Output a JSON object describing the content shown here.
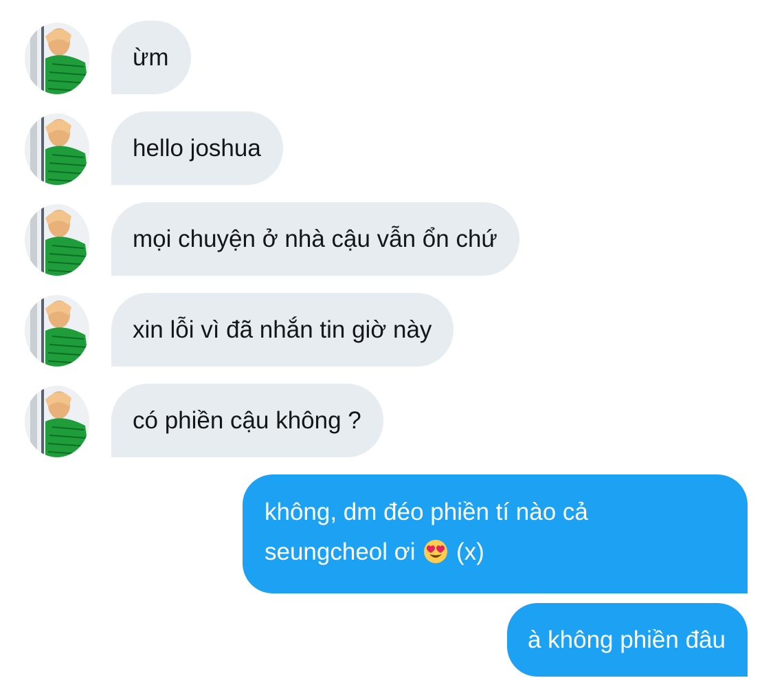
{
  "conversation": {
    "incoming": [
      {
        "text": "ừm"
      },
      {
        "text": "hello joshua"
      },
      {
        "text": "mọi chuyện ở nhà cậu vẫn ổn chứ"
      },
      {
        "text": "xin lỗi vì đã nhắn tin giờ này"
      },
      {
        "text": "có phiền cậu không ?"
      }
    ],
    "outgoing": [
      {
        "line1": "không, dm đéo phiền tí nào cả",
        "line2_before": "seungcheol ơi",
        "line2_emoji": "heart-eyes-emoji",
        "line2_after": "(x)"
      },
      {
        "text": "à không phiền đâu"
      }
    ]
  },
  "colors": {
    "incoming_bubble": "#e6ecf0",
    "outgoing_bubble": "#1da1f2",
    "incoming_text": "#14171a",
    "outgoing_text": "#ffffff"
  },
  "icons": {
    "avatar": "avatar"
  }
}
